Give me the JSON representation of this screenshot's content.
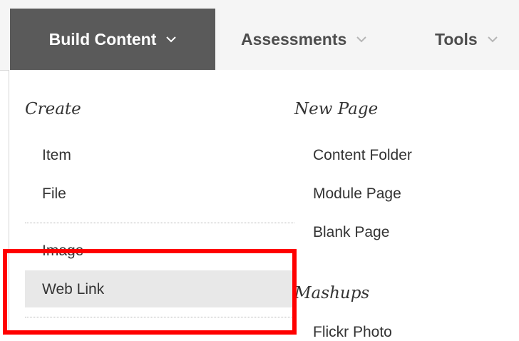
{
  "toolbar": {
    "tabs": [
      {
        "label": "Build Content",
        "active": true
      },
      {
        "label": "Assessments",
        "active": false
      },
      {
        "label": "Tools",
        "active": false
      }
    ]
  },
  "menu": {
    "left_column": {
      "heading": "Create",
      "items": [
        "Item",
        "File",
        "Image",
        "Web Link"
      ]
    },
    "right_column": {
      "heading_new_page": "New Page",
      "new_page_items": [
        "Content Folder",
        "Module Page",
        "Blank Page"
      ],
      "heading_mashups": "Mashups",
      "mashup_items": [
        "Flickr Photo"
      ]
    }
  },
  "colors": {
    "active_tab_bg": "#5a5a5a",
    "hover_row_bg": "#e8e8e8",
    "annotation_box": "#ff0000"
  },
  "icons": [
    "chevron-down-icon"
  ]
}
